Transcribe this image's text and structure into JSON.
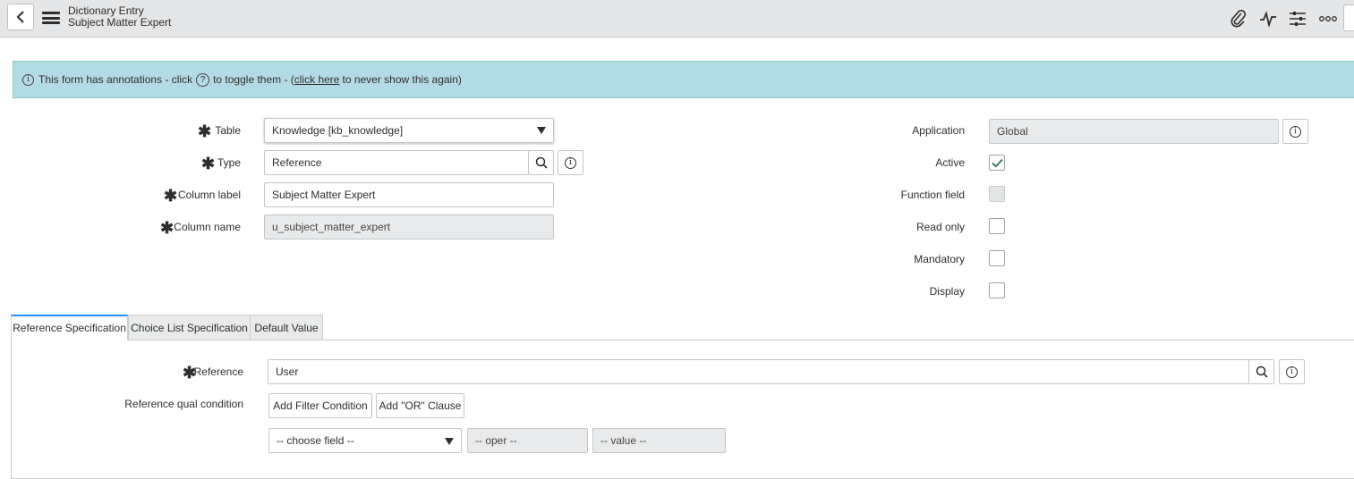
{
  "header": {
    "title": "Dictionary Entry",
    "subtitle": "Subject Matter Expert",
    "icons": [
      "attachment-icon",
      "activity-icon",
      "settings-sliders-icon",
      "more-icon"
    ]
  },
  "annotation": {
    "text_before": "This form has annotations - click",
    "help_glyph": "?",
    "text_middle": "to toggle them - (",
    "link": "click here",
    "text_after": "to never show this again)"
  },
  "form": {
    "table": {
      "label": "Table",
      "value": "Knowledge [kb_knowledge]"
    },
    "type": {
      "label": "Type",
      "value": "Reference"
    },
    "column_label": {
      "label": "Column label",
      "value": "Subject Matter Expert"
    },
    "column_name": {
      "label": "Column name",
      "value": "u_subject_matter_expert"
    },
    "application": {
      "label": "Application",
      "value": "Global"
    },
    "active": {
      "label": "Active",
      "checked": true
    },
    "function_field": {
      "label": "Function field",
      "checked": false
    },
    "read_only": {
      "label": "Read only",
      "checked": false
    },
    "mandatory": {
      "label": "Mandatory",
      "checked": false
    },
    "display": {
      "label": "Display",
      "checked": false
    }
  },
  "tabs": [
    {
      "label": "Reference Specification",
      "active": true
    },
    {
      "label": "Choice List Specification",
      "active": false
    },
    {
      "label": "Default Value",
      "active": false
    }
  ],
  "reference_spec": {
    "reference_label": "Reference",
    "reference_value": "User",
    "qual_label": "Reference qual condition",
    "add_filter": "Add Filter Condition",
    "add_or": "Add \"OR\" Clause",
    "choose_field": "-- choose field --",
    "oper": "-- oper --",
    "value": "-- value --"
  },
  "colors": {
    "accent": "#278efc",
    "annotation_bg": "#b3dbe3",
    "header_bg": "#e4e6e7"
  }
}
